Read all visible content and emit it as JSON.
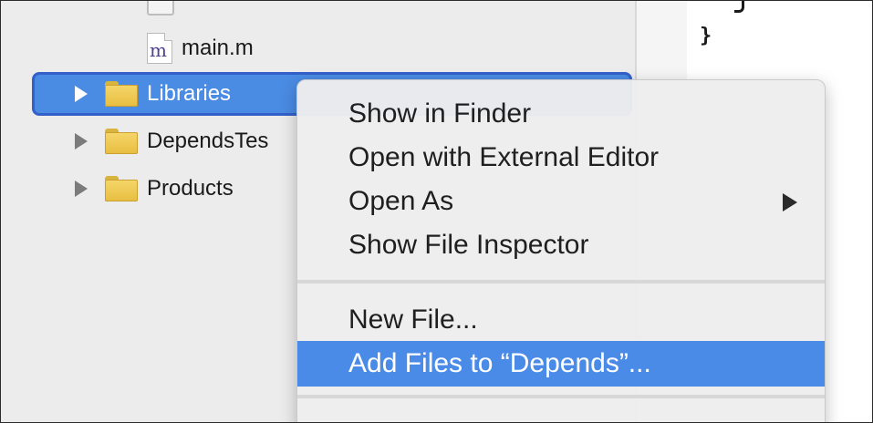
{
  "editor": {
    "closing_brace": "}"
  },
  "navigator": {
    "file": {
      "icon_letter": "m",
      "label": "main.m"
    },
    "groups": [
      {
        "label": "Libraries",
        "selected": true
      },
      {
        "label": "DependsTes",
        "selected": false
      },
      {
        "label": "Products",
        "selected": false
      }
    ]
  },
  "context_menu": {
    "items": [
      {
        "label": "Show in Finder"
      },
      {
        "label": "Open with External Editor"
      },
      {
        "label": "Open As",
        "has_submenu": true
      },
      {
        "label": "Show File Inspector"
      },
      {
        "label": "New File..."
      },
      {
        "label": "Add Files to “Depends”...",
        "highlighted": true
      }
    ]
  },
  "colors": {
    "selection": "#4a8be3",
    "menu_highlight": "#4b8be8",
    "folder": "#f0cc58"
  }
}
